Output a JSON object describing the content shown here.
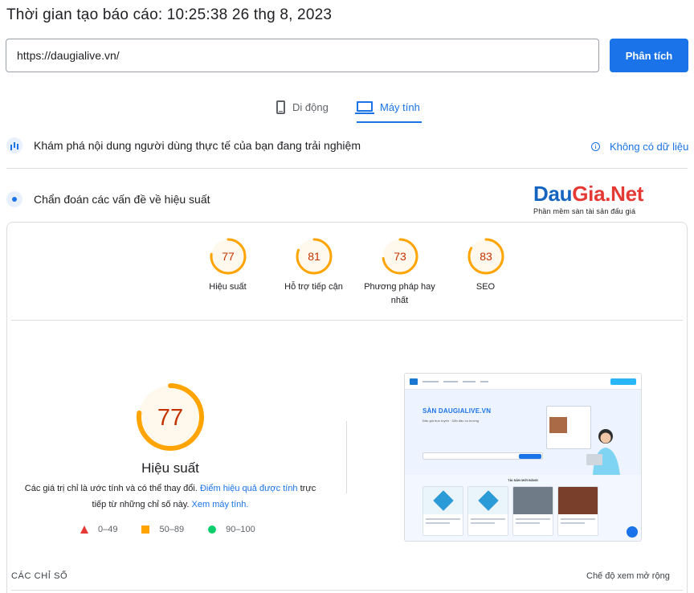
{
  "header": {
    "report_time": "Thời gian tạo báo cáo: 10:25:38 26 thg 8, 2023"
  },
  "url_input": {
    "value": "https://daugialive.vn/"
  },
  "analyze_button": {
    "label": "Phân tích"
  },
  "device_tabs": [
    {
      "label": "Di động",
      "selected": false,
      "icon": "phone-icon"
    },
    {
      "label": "Máy tính",
      "selected": true,
      "icon": "laptop-icon"
    }
  ],
  "crux": {
    "text": "Khám phá nội dung người dùng thực tế của bạn đang trải nghiệm",
    "no_data": "Không có dữ liệu"
  },
  "lab": {
    "text": "Chẩn đoán các vấn đề về hiệu suất"
  },
  "logo": {
    "part1": "Dau",
    "part2": "Gia.Net",
    "tagline": "Phần mềm sàn tài sản đấu giá"
  },
  "categories": [
    {
      "label": "Hiệu suất",
      "score": 77
    },
    {
      "label": "Hỗ trợ tiếp cận",
      "score": 81
    },
    {
      "label": "Phương pháp hay nhất",
      "score": 73
    },
    {
      "label": "SEO",
      "score": 83
    }
  ],
  "performance": {
    "score": 77,
    "title": "Hiệu suất",
    "desc_1": "Các giá trị chỉ là ước tính và có thể thay đổi. ",
    "desc_link_1": "Điểm hiệu quả được tính",
    "desc_2": " trực tiếp từ những chỉ số này. ",
    "desc_link_2": "Xem máy tính."
  },
  "legend": [
    {
      "label": "0–49",
      "shape": "triangle",
      "color": "#e53935"
    },
    {
      "label": "50–89",
      "shape": "square",
      "color": "#ffa400"
    },
    {
      "label": "90–100",
      "shape": "circle",
      "color": "#0cce6b"
    }
  ],
  "screenshot": {
    "hero_title": "SÀN DAUGIALIVE.VN",
    "hero_sub": "Đấu giá trực tuyến · Dẫn đầu xu hướng",
    "section_title": "TÀI SẢN MỚI ĐĂNG"
  },
  "footer": {
    "metrics_label": "CÁC CHỈ SỐ",
    "expand_view": "Chế độ xem mở rộng"
  },
  "colors": {
    "accent": "#1a73e8",
    "average": "#ffa400",
    "average_text": "#c33300"
  }
}
